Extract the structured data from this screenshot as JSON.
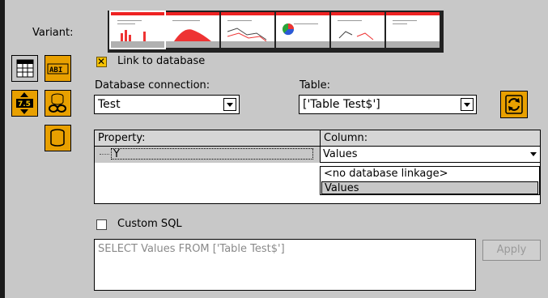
{
  "variant": {
    "label": "Variant:",
    "thumbnails": [
      "bar-chart-thumbnail",
      "area-chart-thumbnail",
      "line-chart-thumbnail",
      "pie-chart-thumbnail",
      "xy-chart-thumbnail",
      "blank-chart-thumbnail"
    ],
    "selected_index": 0
  },
  "toolbar": {
    "icons": [
      "table-icon",
      "text-field-icon",
      "number-spinner-icon",
      "database-link-icon",
      "database-icon"
    ]
  },
  "link": {
    "label": "Link to database",
    "checked": true
  },
  "db_connection": {
    "label": "Database connection:",
    "value": "Test"
  },
  "table": {
    "label": "Table:",
    "value": "['Table Test$']"
  },
  "grid": {
    "headers": [
      "Property:",
      "Column:"
    ],
    "rows": [
      {
        "property": "Y",
        "column": "Values"
      }
    ]
  },
  "column_dropdown": {
    "options": [
      "<no database linkage>",
      "Values"
    ],
    "highlighted_index": 1
  },
  "custom_sql": {
    "label": "Custom SQL",
    "checked": false,
    "query": "SELECT Values FROM ['Table Test$']"
  },
  "apply_button": {
    "label": "Apply"
  },
  "colors": {
    "accent": "#e8a000",
    "background": "#c8c8c8",
    "highlight": "#c8c8c8"
  }
}
